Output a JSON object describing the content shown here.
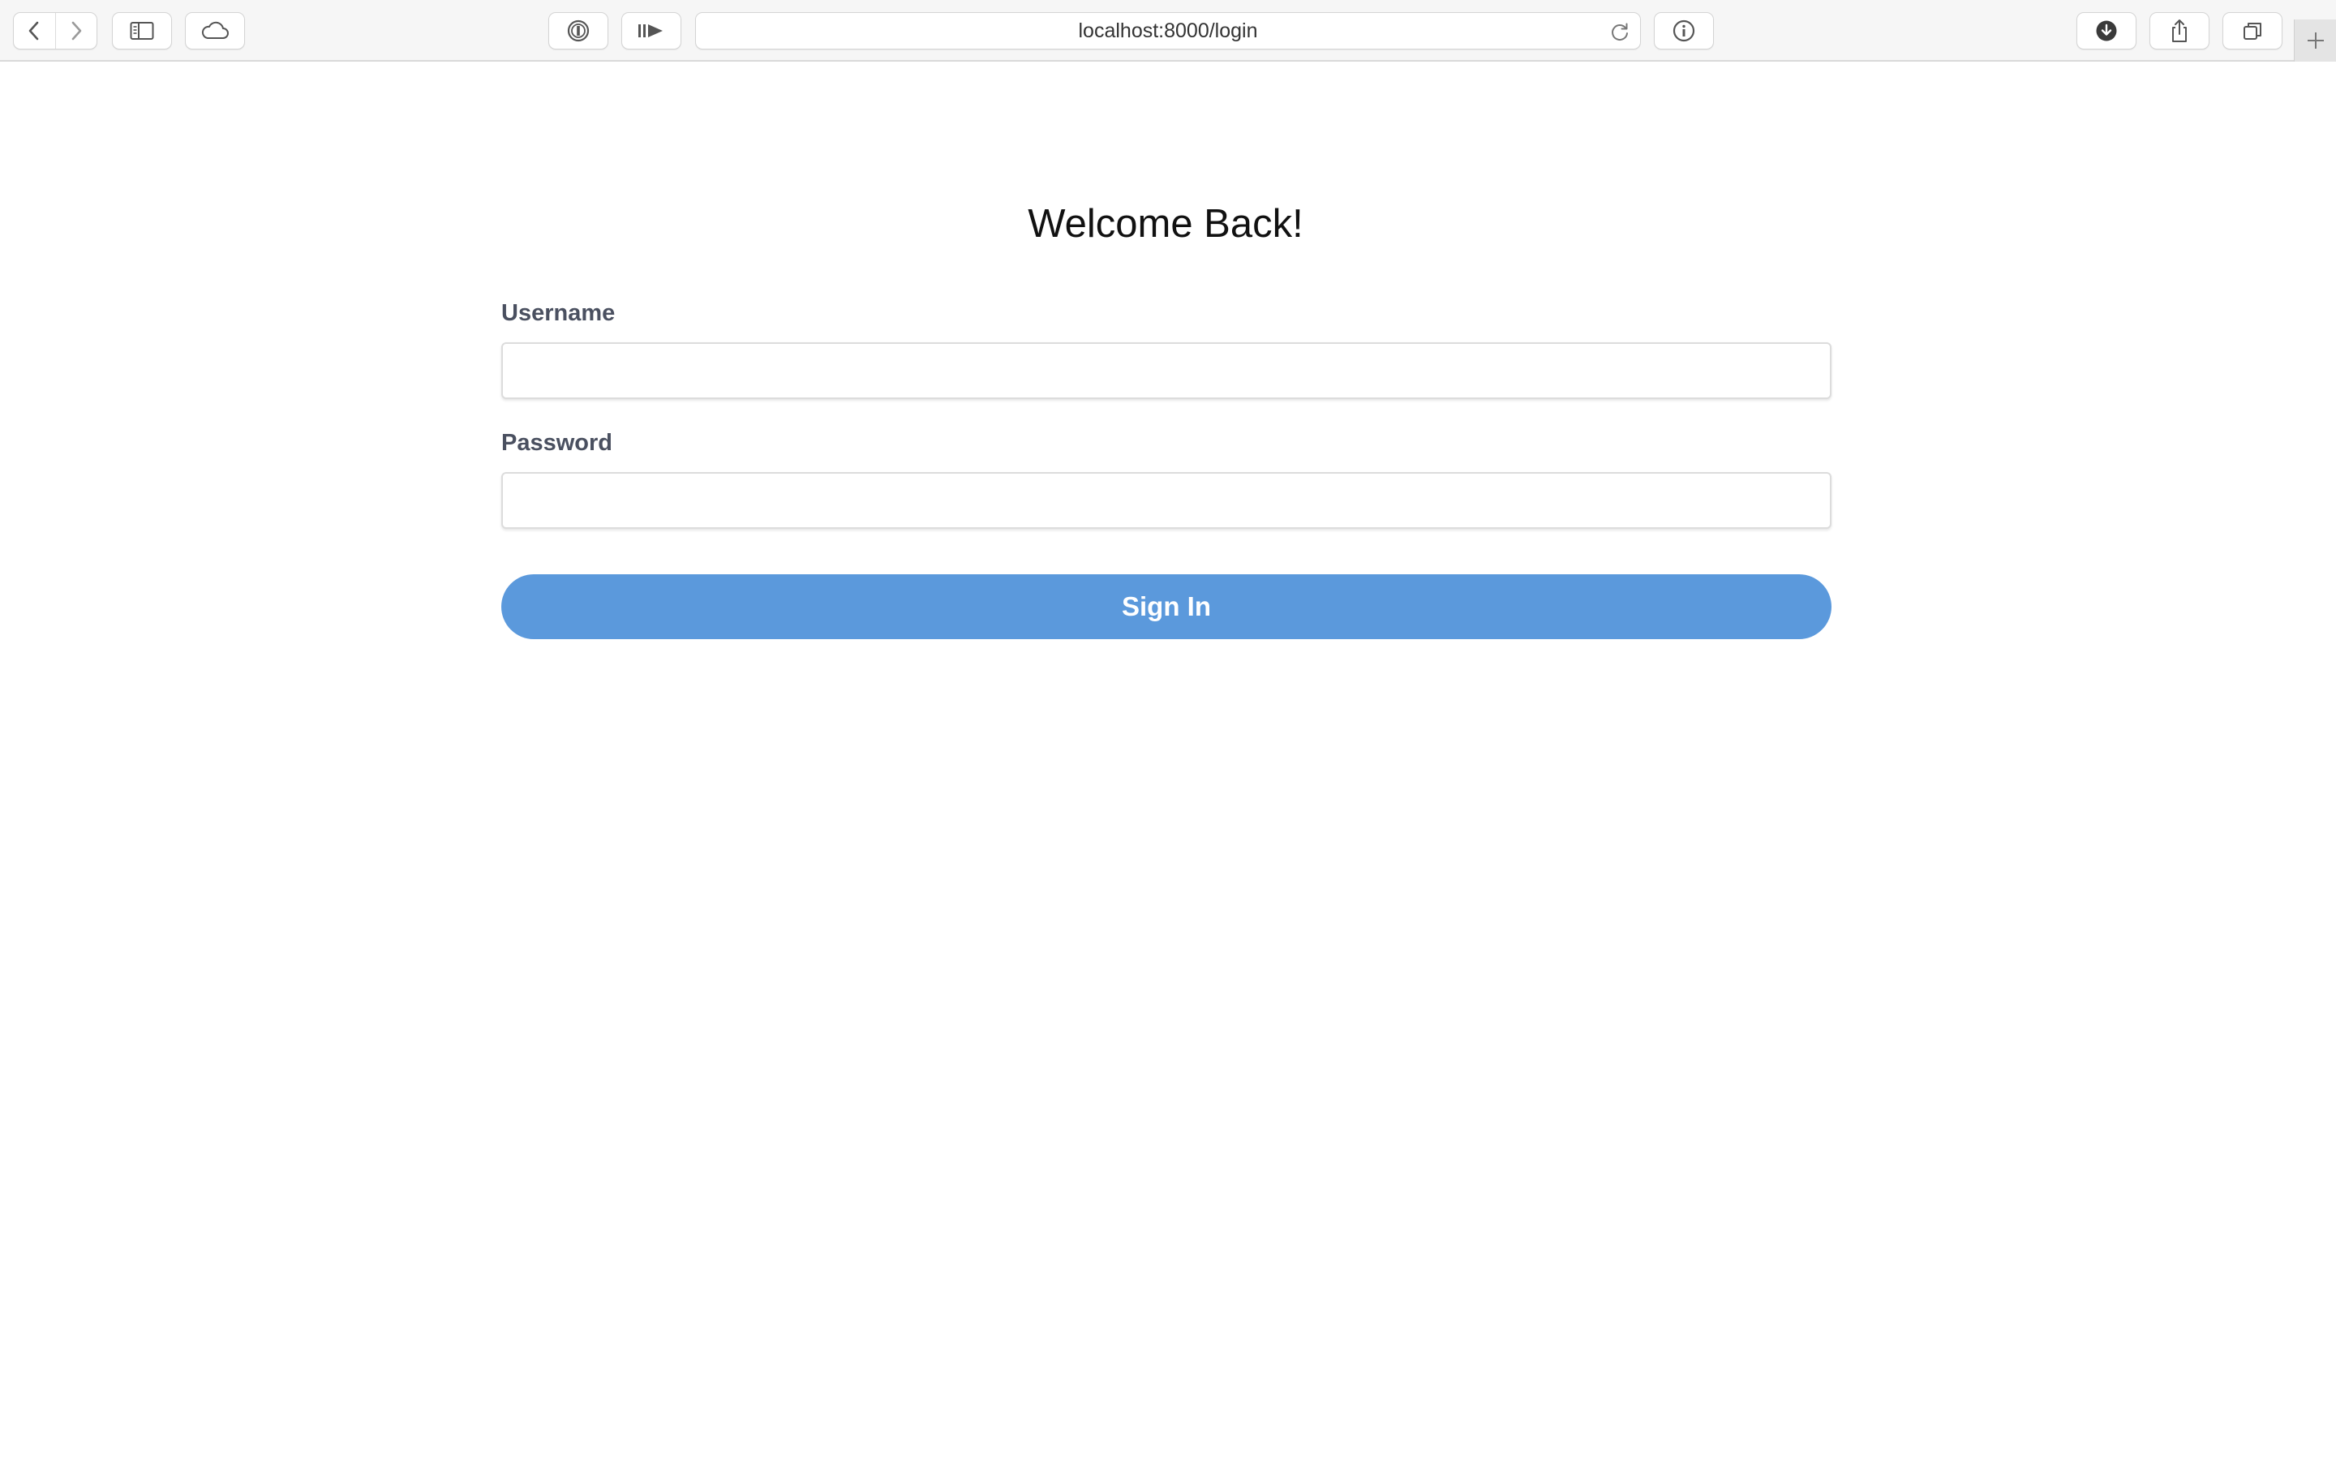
{
  "browser": {
    "url": "localhost:8000/login",
    "icons": {
      "back": "chevron-left-icon",
      "forward": "chevron-right-icon",
      "sidebar": "sidebar-icon",
      "cloud": "icloud-tabs-icon",
      "password_manager": "1password-icon",
      "reader": "reader-play-icon",
      "reload": "reload-icon",
      "info": "info-icon",
      "downloads": "download-icon",
      "share": "share-icon",
      "tabs": "tab-overview-icon",
      "new_tab": "plus-icon"
    }
  },
  "page": {
    "heading": "Welcome Back!",
    "form": {
      "username_label": "Username",
      "username_value": "",
      "password_label": "Password",
      "password_value": "",
      "submit_label": "Sign In"
    },
    "colors": {
      "accent": "#5b99dc",
      "label": "#4a5060"
    }
  }
}
